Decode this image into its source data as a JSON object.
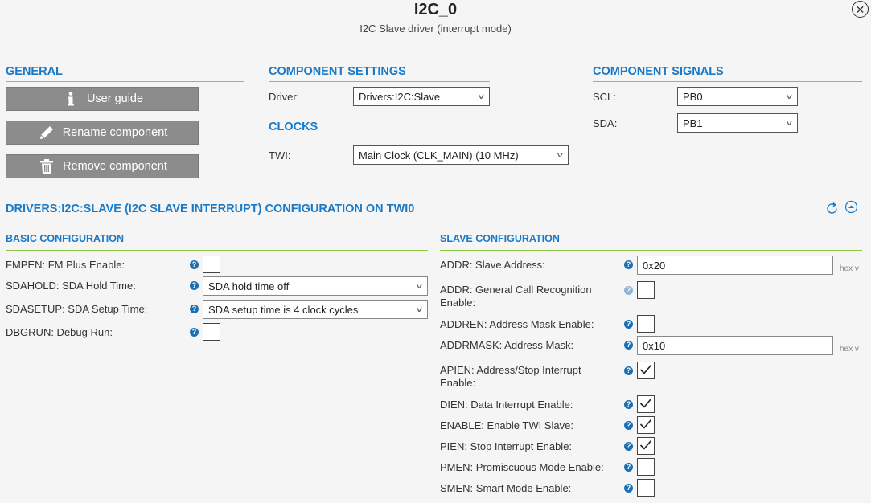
{
  "header": {
    "title": "I2C_0",
    "subtitle": "I2C Slave driver (interrupt mode)",
    "close_glyph": "✕"
  },
  "general": {
    "title": "GENERAL",
    "buttons": [
      {
        "label": "User guide",
        "icon": "info-icon"
      },
      {
        "label": "Rename component",
        "icon": "pencil-icon"
      },
      {
        "label": "Remove component",
        "icon": "trash-icon"
      }
    ]
  },
  "component_settings": {
    "title": "COMPONENT SETTINGS",
    "driver_label": "Driver:",
    "driver_value": "Drivers:I2C:Slave"
  },
  "clocks": {
    "title": "CLOCKS",
    "twi_label": "TWI:",
    "twi_value": "Main Clock (CLK_MAIN) (10 MHz)"
  },
  "component_signals": {
    "title": "COMPONENT SIGNALS",
    "scl_label": "SCL:",
    "scl_value": "PB0",
    "sda_label": "SDA:",
    "sda_value": "PB1"
  },
  "config": {
    "title": "DRIVERS:I2C:SLAVE (I2C SLAVE INTERRUPT) CONFIGURATION ON TWI0"
  },
  "basic": {
    "title": "BASIC CONFIGURATION",
    "fmpen_label": "FMPEN: FM Plus Enable:",
    "fmpen_checked": false,
    "sdahold_label": "SDAHOLD: SDA Hold Time:",
    "sdahold_value": "SDA hold time off",
    "sdasetup_label": "SDASETUP: SDA Setup Time:",
    "sdasetup_value": "SDA setup time is 4 clock cycles",
    "dbgrun_label": "DBGRUN: Debug Run:",
    "dbgrun_checked": false
  },
  "slave": {
    "title": "SLAVE CONFIGURATION",
    "addr_label": "ADDR: Slave Address:",
    "addr_value": "0x20",
    "addr_unit": "hex v",
    "gcr_label": "ADDR: General Call Recognition Enable:",
    "gcr_checked": false,
    "addren_label": "ADDREN: Address Mask Enable:",
    "addren_checked": false,
    "addrmask_label": "ADDRMASK: Address Mask:",
    "addrmask_value": "0x10",
    "addrmask_unit": "hex v",
    "apien_label": "APIEN: Address/Stop Interrupt Enable:",
    "apien_checked": true,
    "dien_label": "DIEN: Data Interrupt Enable:",
    "dien_checked": true,
    "enable_label": "ENABLE: Enable TWI Slave:",
    "enable_checked": true,
    "pien_label": "PIEN: Stop Interrupt Enable:",
    "pien_checked": true,
    "pmen_label": "PMEN: Promiscuous Mode Enable:",
    "pmen_checked": false,
    "smen_label": "SMEN: Smart Mode Enable:",
    "smen_checked": false
  },
  "colors": {
    "accent": "#1a7ac7",
    "divider": "#8dc63f",
    "button": "#8c8c8c",
    "help": "#1a6fb5"
  }
}
